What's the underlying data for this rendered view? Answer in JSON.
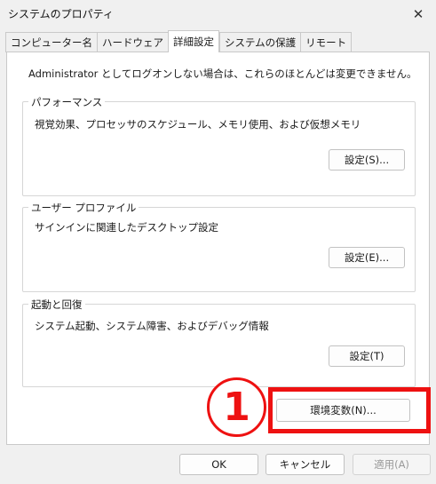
{
  "window": {
    "title": "システムのプロパティ"
  },
  "tabs": [
    {
      "label": "コンピューター名"
    },
    {
      "label": "ハードウェア"
    },
    {
      "label": "詳細設定",
      "active": true
    },
    {
      "label": "システムの保護"
    },
    {
      "label": "リモート"
    }
  ],
  "advanced": {
    "intro": "Administrator としてログオンしない場合は、これらのほとんどは変更できません。",
    "performance": {
      "legend": "パフォーマンス",
      "desc": "視覚効果、プロセッサのスケジュール、メモリ使用、および仮想メモリ",
      "button": "設定(S)..."
    },
    "user_profile": {
      "legend": "ユーザー プロファイル",
      "desc": "サインインに関連したデスクトップ設定",
      "button": "設定(E)..."
    },
    "startup": {
      "legend": "起動と回復",
      "desc": "システム起動、システム障害、およびデバッグ情報",
      "button": "設定(T)"
    },
    "env_button": "環境変数(N)..."
  },
  "annotation": {
    "number": "1",
    "color": "#ee1111"
  },
  "footer": {
    "ok": "OK",
    "cancel": "キャンセル",
    "apply": "適用(A)"
  }
}
